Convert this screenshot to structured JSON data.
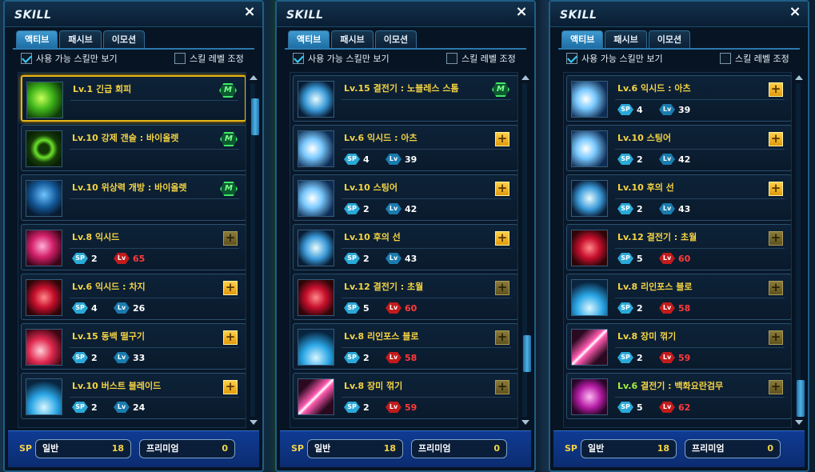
{
  "panels": [
    {
      "title": "SKILL",
      "tabs": [
        "액티브",
        "패시브",
        "이모션"
      ],
      "option_usable": "사용 가능 스킬만 보기",
      "option_level": "스킬 레벨 조정",
      "scroll_position": 0.05,
      "rows": [
        {
          "name": "Lv.1 긴급 회피",
          "badge": "M",
          "icon": "green-swirl-icon",
          "selected": true
        },
        {
          "name": "Lv.10 강제 갠슬 : 바이올렛",
          "badge": "M",
          "icon": "green-ring-icon"
        },
        {
          "name": "Lv.10 위상력 개방 : 바이올렛",
          "badge": "M",
          "icon": "blue-figure-icon"
        },
        {
          "name": "Lv.8 익시드",
          "badge": "+dim",
          "icon": "pink-figure-icon",
          "sp": "2",
          "lv": "65",
          "lv_red": true
        },
        {
          "name": "Lv.6 익시드 : 차지",
          "badge": "+",
          "icon": "red-figure-icon",
          "sp": "4",
          "lv": "26"
        },
        {
          "name": "Lv.15 동백 떨구기",
          "badge": "+",
          "icon": "red-fan-icon",
          "sp": "2",
          "lv": "33"
        },
        {
          "name": "Lv.10 버스트 블레이드",
          "badge": "+",
          "icon": "blue-burst-icon",
          "sp": "2",
          "lv": "24"
        }
      ],
      "sp": {
        "label": "SP",
        "normal_label": "일반",
        "normal_value": "18",
        "premium_label": "프리미엄",
        "premium_value": "0"
      }
    },
    {
      "title": "SKILL",
      "tabs": [
        "액티브",
        "패시브",
        "이모션"
      ],
      "option_usable": "사용 가능 스킬만 보기",
      "option_level": "스킬 레벨 조정",
      "scroll_position": 0.85,
      "rows": [
        {
          "name": "Lv.15 결전기 : 노블레스 스톰",
          "badge": "M",
          "icon": "blue-storm-icon"
        },
        {
          "name": "Lv.6 익시드 : 아츠",
          "badge": "+",
          "icon": "blue-white-icon",
          "sp": "4",
          "lv": "39"
        },
        {
          "name": "Lv.10 스팅어",
          "badge": "+",
          "icon": "blue-white-icon",
          "sp": "2",
          "lv": "42"
        },
        {
          "name": "Lv.10 후의 선",
          "badge": "+",
          "icon": "blue-storm-icon",
          "sp": "2",
          "lv": "43"
        },
        {
          "name": "Lv.12 결전기 : 초월",
          "badge": "+dim",
          "icon": "red-figure-icon",
          "sp": "5",
          "lv": "60",
          "lv_red": true
        },
        {
          "name": "Lv.8 리인포스 블로",
          "badge": "+dim",
          "icon": "blue-burst-icon",
          "sp": "2",
          "lv": "58",
          "lv_red": true
        },
        {
          "name": "Lv.8 장미 꺾기",
          "badge": "+dim",
          "icon": "slash-icon",
          "sp": "2",
          "lv": "59",
          "lv_red": true
        }
      ],
      "sp": {
        "label": "SP",
        "normal_label": "일반",
        "normal_value": "18",
        "premium_label": "프리미엄",
        "premium_value": "0"
      }
    },
    {
      "title": "SKILL",
      "tabs": [
        "액티브",
        "패시브",
        "이모션"
      ],
      "option_usable": "사용 가능 스킬만 보기",
      "option_level": "스킬 레벨 조정",
      "scroll_position": 1.0,
      "rows": [
        {
          "name": "Lv.6 익시드 : 아츠",
          "badge": "+",
          "icon": "blue-white-icon",
          "sp": "4",
          "lv": "39"
        },
        {
          "name": "Lv.10 스팅어",
          "badge": "+",
          "icon": "blue-white-icon",
          "sp": "2",
          "lv": "42"
        },
        {
          "name": "Lv.10 후의 선",
          "badge": "+",
          "icon": "blue-storm-icon",
          "sp": "2",
          "lv": "43"
        },
        {
          "name": "Lv.12 결전기 : 초월",
          "badge": "+dim",
          "icon": "red-figure-icon",
          "sp": "5",
          "lv": "60",
          "lv_red": true
        },
        {
          "name": "Lv.8 리인포스 블로",
          "badge": "+dim",
          "icon": "blue-burst-icon",
          "sp": "2",
          "lv": "58",
          "lv_red": true
        },
        {
          "name": "Lv.8 장미 꺾기",
          "badge": "+dim",
          "icon": "slash-icon",
          "sp": "2",
          "lv": "59",
          "lv_red": true
        },
        {
          "name_level": "Lv.6",
          "name_rest": " 결전기 : 백화요란검무",
          "green_level": true,
          "badge": "+dim",
          "icon": "magenta-icon",
          "sp": "5",
          "lv": "62",
          "lv_red": true
        }
      ],
      "sp": {
        "label": "SP",
        "normal_label": "일반",
        "normal_value": "18",
        "premium_label": "프리미엄",
        "premium_value": "0"
      }
    }
  ],
  "badge_labels": {
    "sp": "SP",
    "lv": "Lv",
    "m": "M",
    "plus": "+"
  },
  "close_glyph": "×"
}
